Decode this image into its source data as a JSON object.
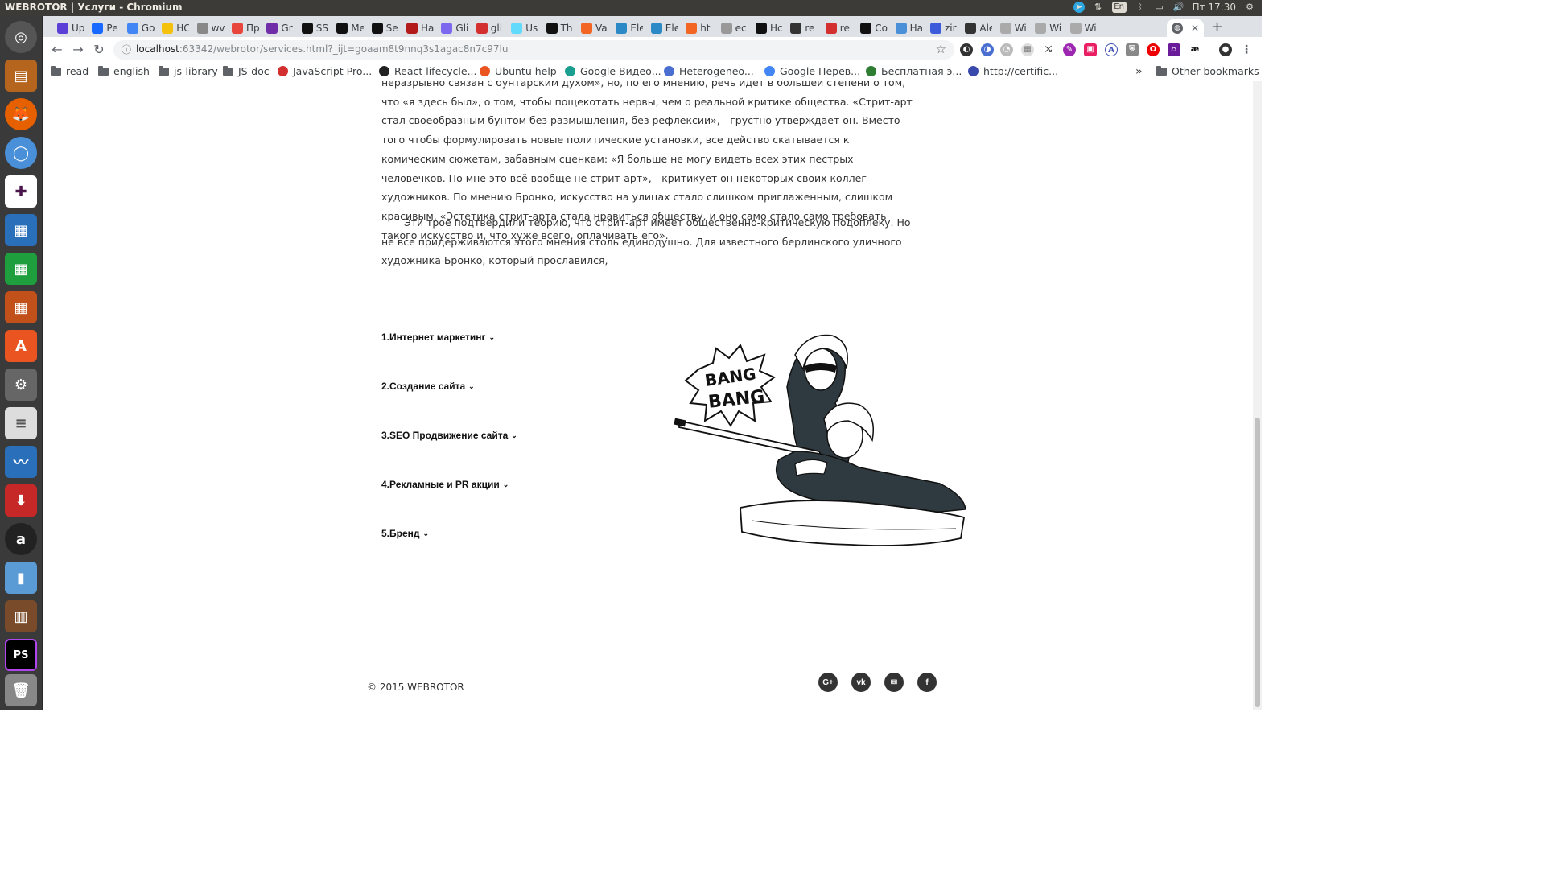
{
  "window": {
    "title": "WEBROTOR | Услуги - Chromium"
  },
  "system_tray": {
    "keyboard_layout": "En",
    "clock": "Пт 17:30"
  },
  "tabs": [
    {
      "label": "Up",
      "color": "#5b3fd6"
    },
    {
      "label": "Pe",
      "color": "#1769ff"
    },
    {
      "label": "Go",
      "color": "#4285f4"
    },
    {
      "label": "HC",
      "color": "#f4c20d"
    },
    {
      "label": "wv",
      "color": "#888888"
    },
    {
      "label": "Пр",
      "color": "#e8453c"
    },
    {
      "label": "Gr",
      "color": "#6f2da8"
    },
    {
      "label": "SS",
      "color": "#111111"
    },
    {
      "label": "Me",
      "color": "#111111"
    },
    {
      "label": "Se",
      "color": "#111111"
    },
    {
      "label": "Ha",
      "color": "#b31b1b"
    },
    {
      "label": "Gli",
      "color": "#7b68ee"
    },
    {
      "label": "gli",
      "color": "#d32f2f"
    },
    {
      "label": "Us",
      "color": "#61dafb"
    },
    {
      "label": "Th",
      "color": "#111111"
    },
    {
      "label": "Va",
      "color": "#f26522"
    },
    {
      "label": "Ele",
      "color": "#2b8ac6"
    },
    {
      "label": "Ele",
      "color": "#2b8ac6"
    },
    {
      "label": "ht",
      "color": "#f26522"
    },
    {
      "label": "ec",
      "color": "#999999"
    },
    {
      "label": "Hc",
      "color": "#111111"
    },
    {
      "label": "re",
      "color": "#333333"
    },
    {
      "label": "re",
      "color": "#d32f2f"
    },
    {
      "label": "Co",
      "color": "#111111"
    },
    {
      "label": "Ha",
      "color": "#4a90d9"
    },
    {
      "label": "zir",
      "color": "#3b5bdb"
    },
    {
      "label": "Ale",
      "color": "#333333"
    },
    {
      "label": "Wi",
      "color": "#aaaaaa"
    },
    {
      "label": "Wi",
      "color": "#aaaaaa"
    },
    {
      "label": "Wi",
      "color": "#aaaaaa"
    }
  ],
  "address_bar": {
    "host": "localhost",
    "rest": ":63342/webrotor/services.html?_ijt=goaam8t9nnq3s1agac8n7c97lu"
  },
  "bookmarks": {
    "items": [
      {
        "label": "read",
        "type": "folder"
      },
      {
        "label": "english",
        "type": "folder"
      },
      {
        "label": "js-library",
        "type": "folder"
      },
      {
        "label": "JS-doc",
        "type": "folder"
      },
      {
        "label": "JavaScript Pro...",
        "type": "site",
        "color": "#d32f2f"
      },
      {
        "label": "React lifecycle...",
        "type": "site",
        "color": "#222222"
      },
      {
        "label": "Ubuntu help",
        "type": "site",
        "color": "#e95420"
      },
      {
        "label": "Google Видео...",
        "type": "site",
        "color": "#1a9e8f"
      },
      {
        "label": "Heterogeneo...",
        "type": "site",
        "color": "#4a6fd1"
      },
      {
        "label": "Google Перев...",
        "type": "site",
        "color": "#4285f4"
      },
      {
        "label": "Бесплатная э...",
        "type": "site",
        "color": "#2e7d32"
      },
      {
        "label": "http://certific...",
        "type": "site",
        "color": "#3949ab"
      }
    ],
    "overflow": "»",
    "other": "Other bookmarks"
  },
  "article": {
    "para1": "неразрывно связан с бунтарским духом», но, по его мнению, речь идет в большей степени о том, что «я здесь был», о том, чтобы пощекотать нервы, чем о реальной критике общества. «Стрит-арт стал своеобразным бунтом без размышления, без рефлексии», - грустно утверждает он. Вместо того чтобы формулировать новые политические установки, все действо скатывается к комическим сюжетам, забавным сценкам: «Я больше не могу видеть всех этих пестрых человечков. По мне это всё вообще не стрит-арт», - критикует он некоторых своих коллег-художников. По мнению Бронко, искусство на улицах стало слишком приглаженным, слишком красивым. «Эстетика стрит-арта стала нравиться обществу, и оно само стало само требовать такого искусство и, что хуже всего, оплачивать его».",
    "para2": "Эти трое подтвердили теорию, что стрит-арт имеет общественно-критическую подоплеку. Но не все придерживаются этого мнения столь единодушно. Для известного берлинского уличного художника Бронко, который прославился,"
  },
  "services": [
    "1.Интернет маркетинг",
    "2.Создание сайта",
    "3.SEO Продвижение сайта",
    "4.Рекламные и PR акции",
    "5.Бренд"
  ],
  "illustration": {
    "caption_line1": "BANG",
    "caption_line2": "BANG"
  },
  "footer": {
    "copyright": "© 2015 WEBROTOR",
    "social": [
      {
        "name": "google-plus",
        "glyph": "G+"
      },
      {
        "name": "vk",
        "glyph": "vk"
      },
      {
        "name": "email",
        "glyph": "✉"
      },
      {
        "name": "facebook",
        "glyph": "f"
      }
    ]
  }
}
